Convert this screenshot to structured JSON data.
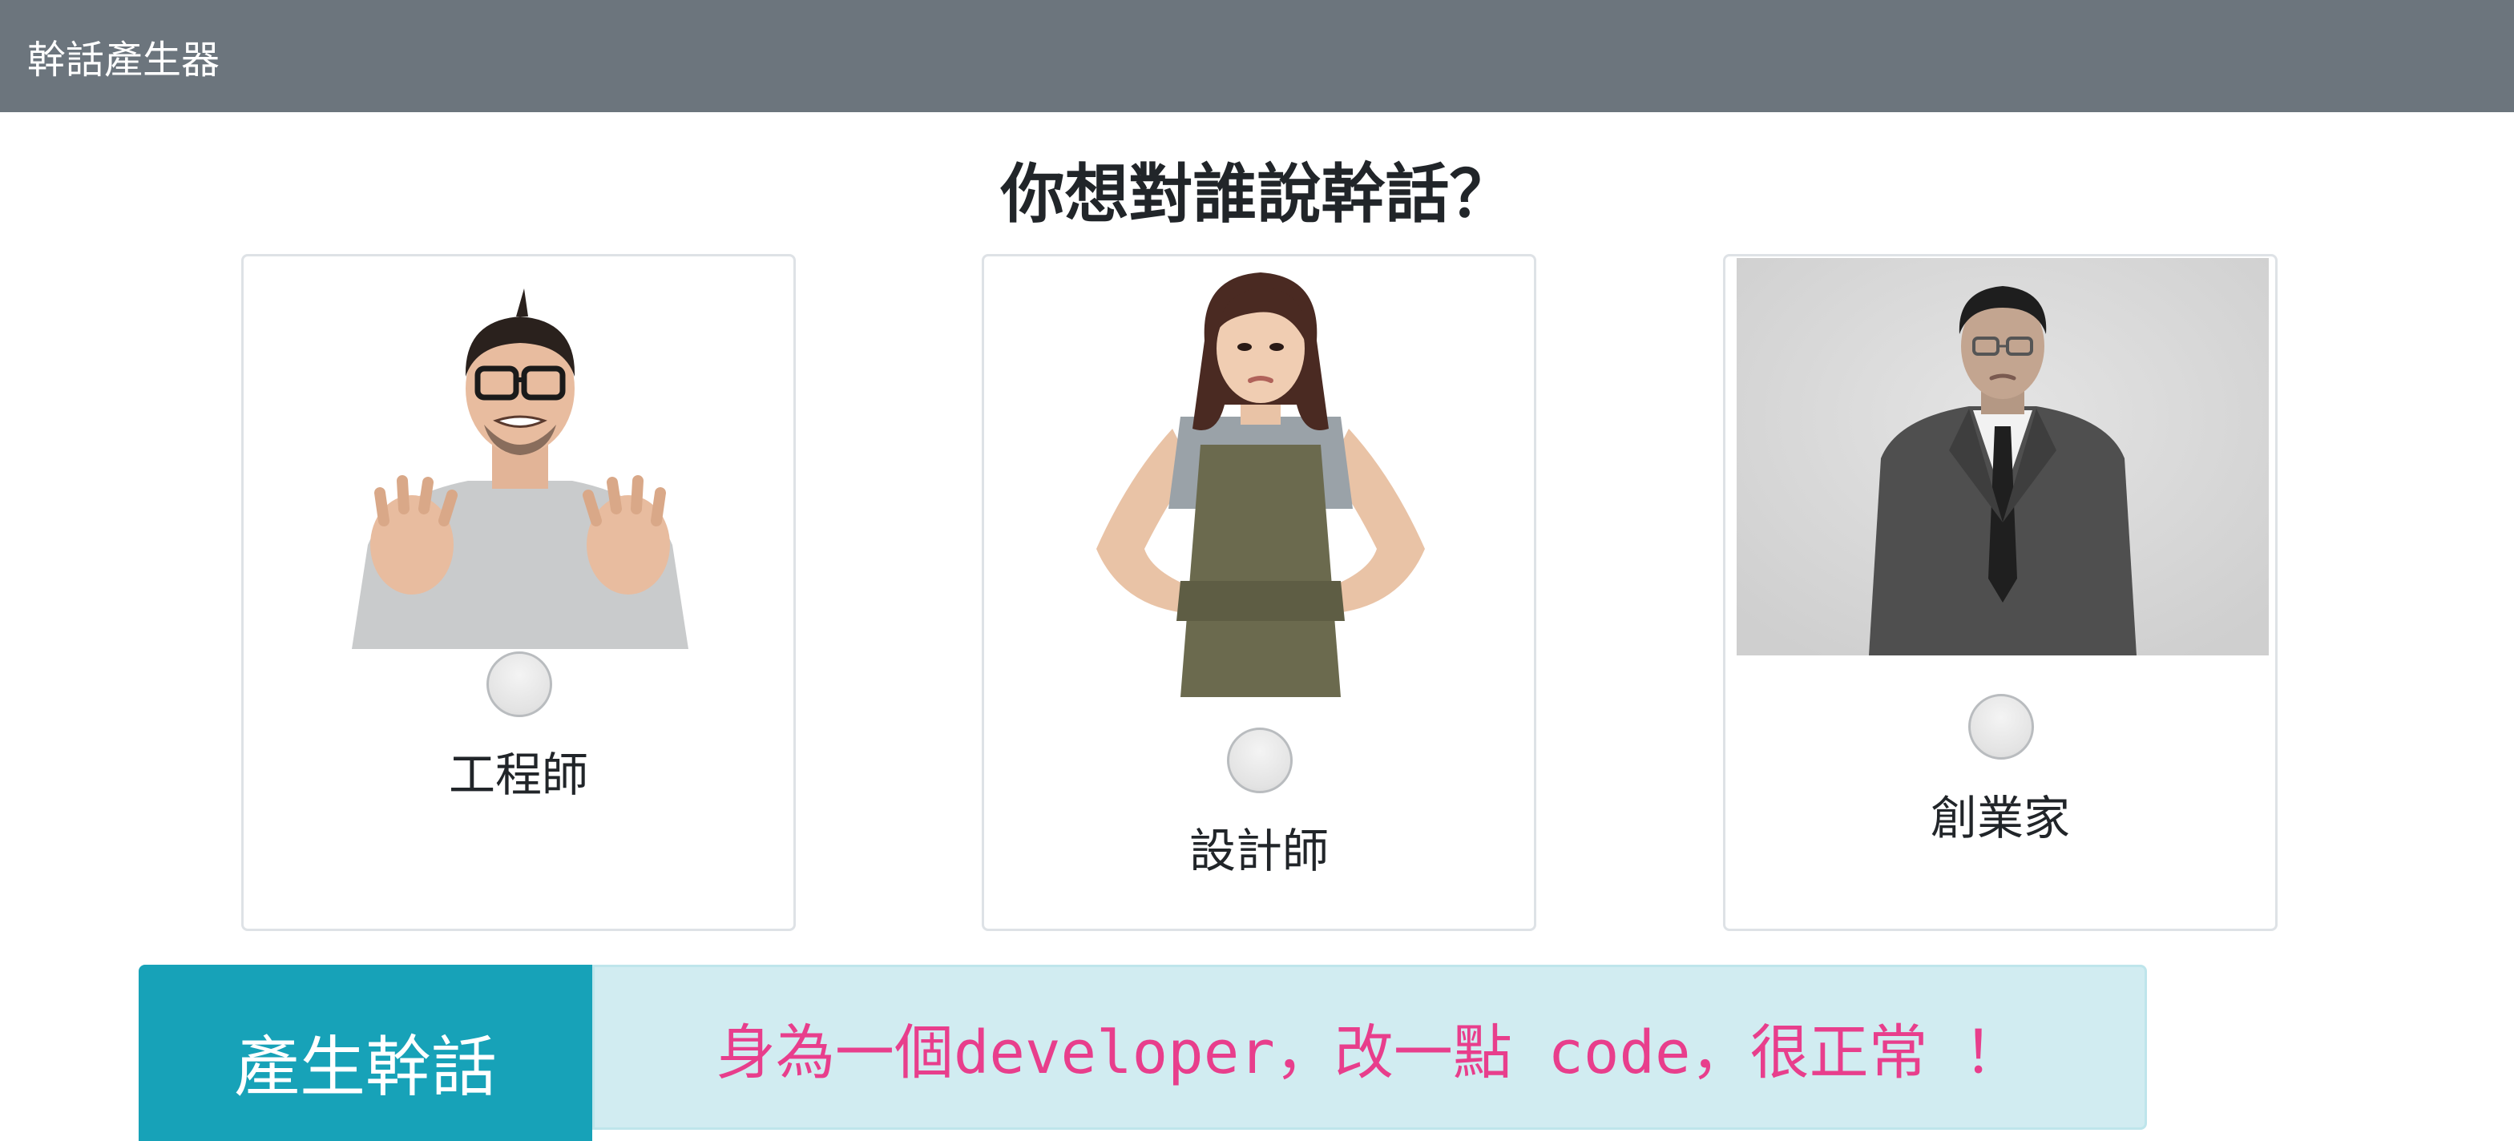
{
  "navbar": {
    "brand": "幹話產生器"
  },
  "heading": "你想對誰說幹話？",
  "roles": [
    {
      "label": "工程師",
      "photo_icon": "engineer-photo"
    },
    {
      "label": "設計師",
      "photo_icon": "designer-photo"
    },
    {
      "label": "創業家",
      "photo_icon": "entrepreneur-photo"
    }
  ],
  "generate_button": "產生幹話",
  "output_text": "身為一個developer，改一點 code，很正常 ！",
  "colors": {
    "navbar": "#6c757d",
    "button": "#17a2b8",
    "output_background": "#d1ecf1",
    "output_text": "#e83e8c"
  }
}
